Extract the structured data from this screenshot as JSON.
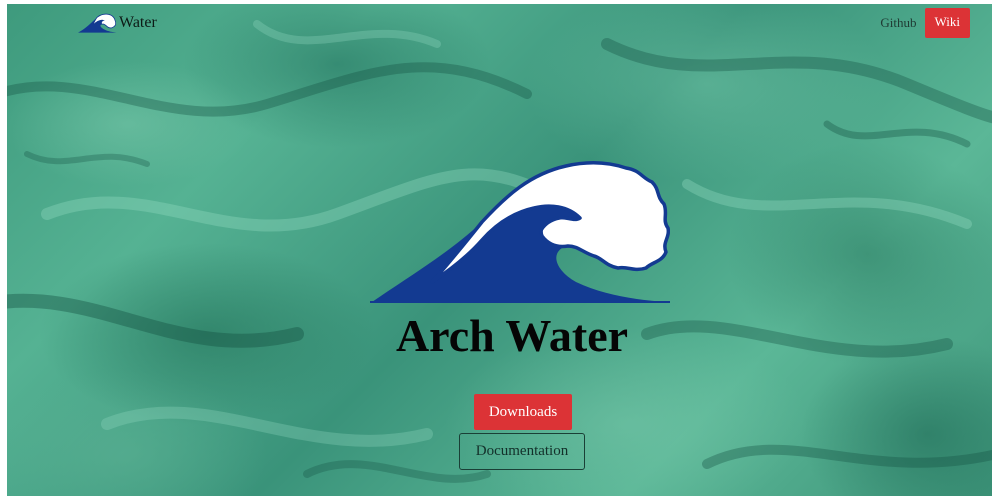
{
  "header": {
    "brand": "Water",
    "nav": {
      "github_label": "Github",
      "wiki_label": "Wiki"
    }
  },
  "hero": {
    "title": "Arch Water",
    "downloads_label": "Downloads",
    "documentation_label": "Documentation"
  },
  "icons": {
    "brand_logo": "wave-icon",
    "hero_logo": "wave-icon"
  },
  "colors": {
    "accent": "#dc3336",
    "wave_blue": "#133a91",
    "background_green": "#4aa586"
  }
}
